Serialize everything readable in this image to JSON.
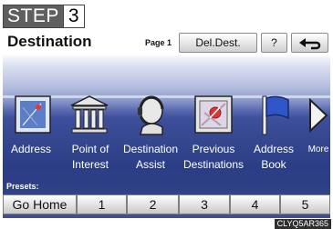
{
  "step": {
    "label": "STEP",
    "number": "3"
  },
  "header": {
    "title": "Destination",
    "page": "Page 1",
    "del_dest": "Del.Dest.",
    "help": "?"
  },
  "icons": [
    {
      "id": "address",
      "line1": "Address",
      "line2": ""
    },
    {
      "id": "point-of-interest",
      "line1": "Point of",
      "line2": "Interest"
    },
    {
      "id": "destination-assist",
      "line1": "Destination",
      "line2": "Assist"
    },
    {
      "id": "previous-destinations",
      "line1": "Previous",
      "line2": "Destinations"
    },
    {
      "id": "address-book",
      "line1": "Address",
      "line2": "Book"
    },
    {
      "id": "more",
      "line1": "More",
      "line2": ""
    }
  ],
  "presets": {
    "label": "Presets:",
    "buttons": [
      "Go Home",
      "1",
      "2",
      "3",
      "4",
      "5"
    ]
  },
  "image_code": "CLYQ5AR365"
}
